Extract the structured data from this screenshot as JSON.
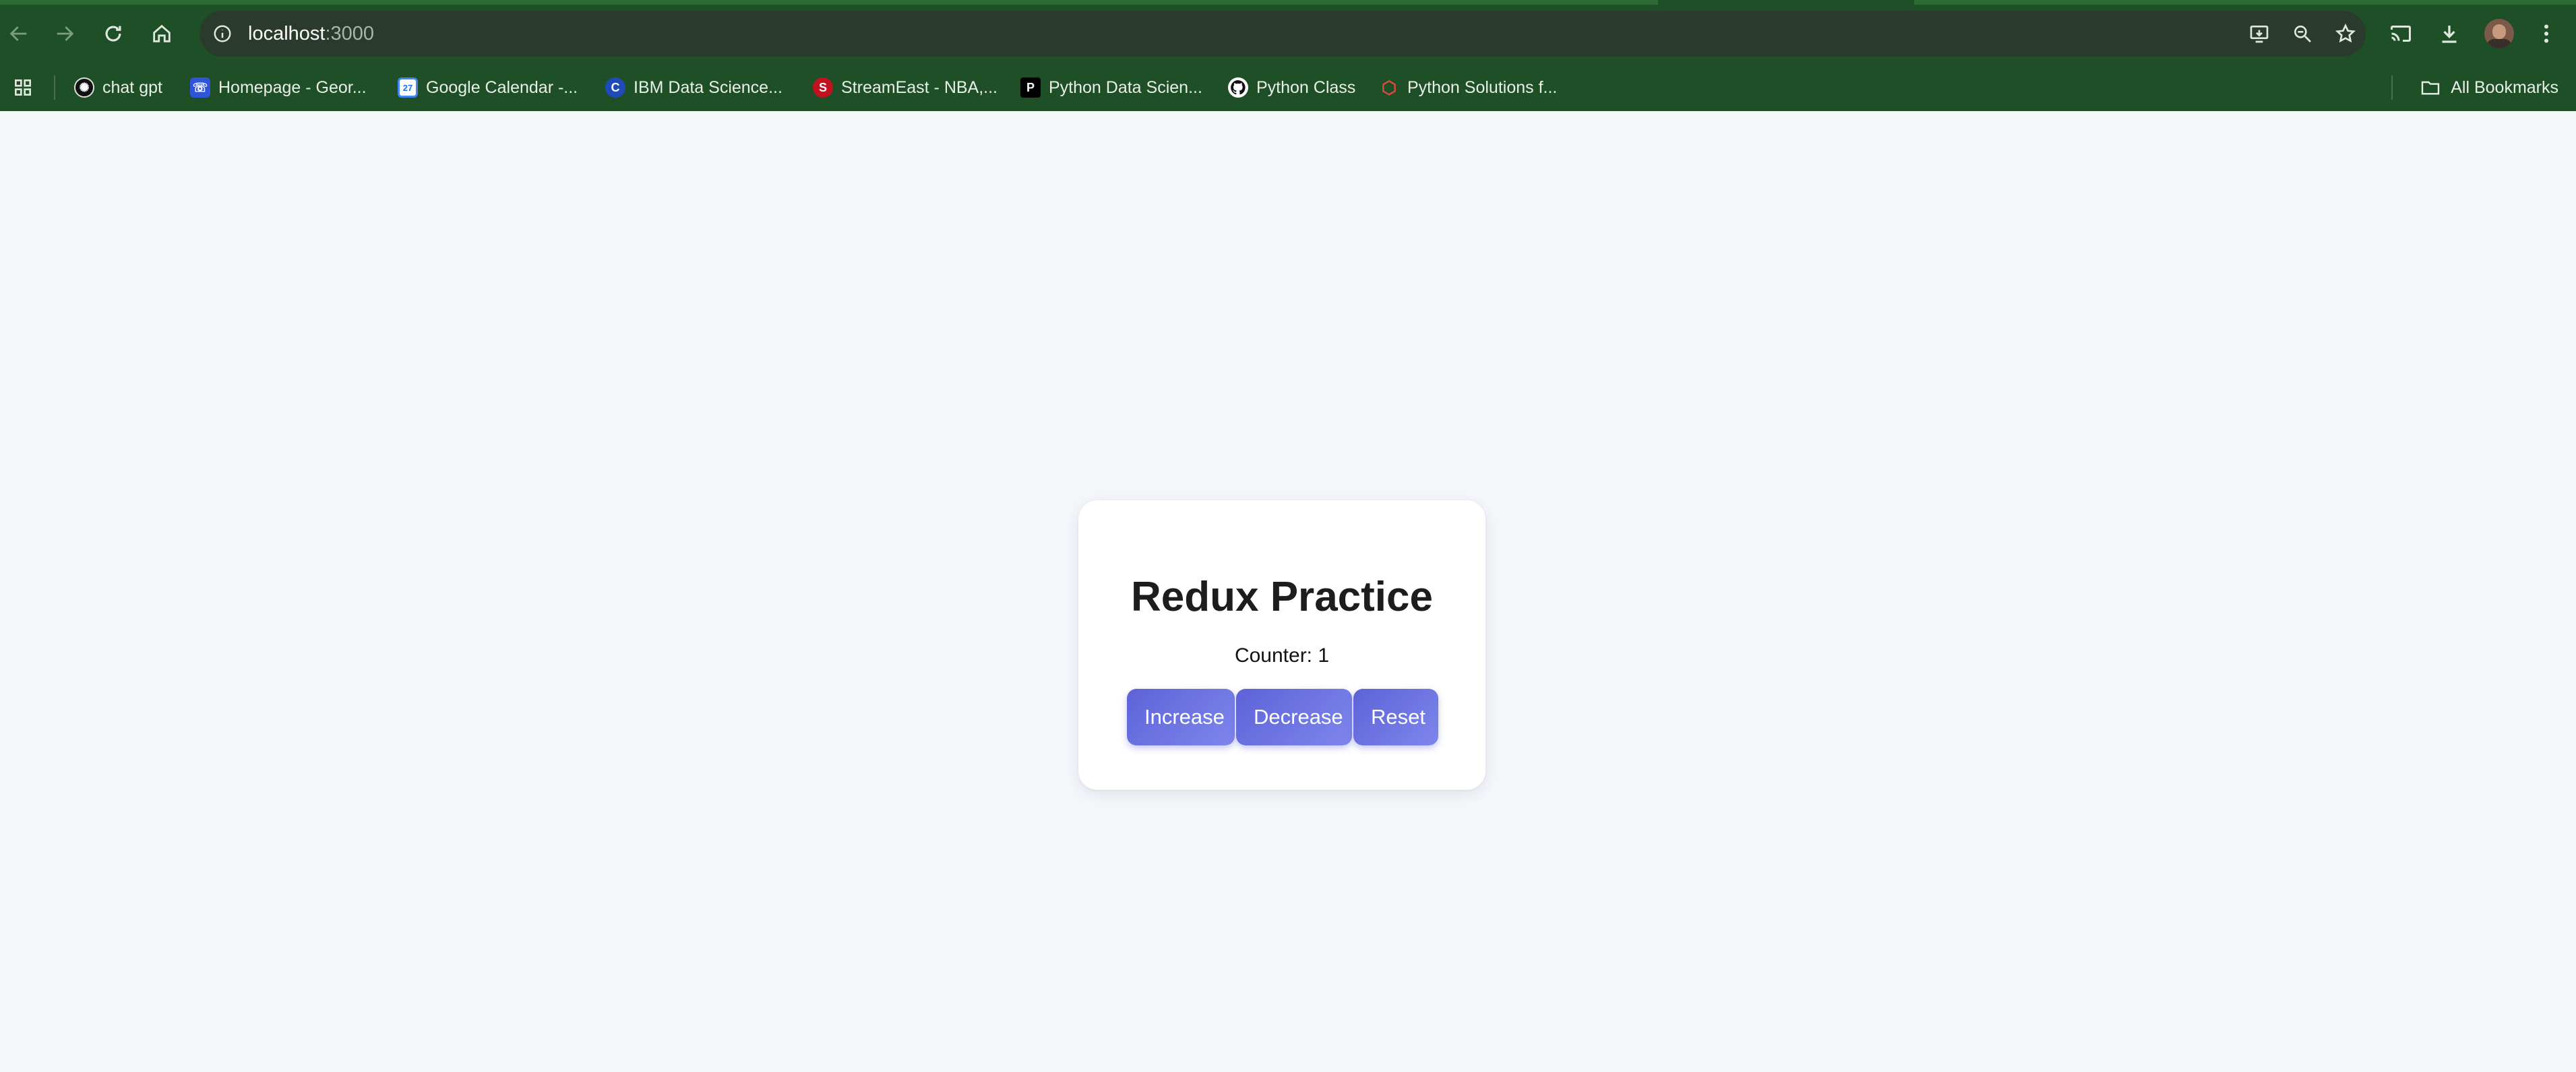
{
  "browser": {
    "url_host": "localhost",
    "url_port": ":3000",
    "bookmarks": [
      {
        "label": "chat gpt",
        "icon": "chatgpt-icon"
      },
      {
        "label": "Homepage - Geor...",
        "icon": "homepage-icon"
      },
      {
        "label": "Google Calendar -...",
        "icon": "calendar-icon",
        "favicon_text": "27"
      },
      {
        "label": "IBM Data Science...",
        "icon": "coursera-icon",
        "favicon_text": "C"
      },
      {
        "label": "StreamEast - NBA,...",
        "icon": "streameast-icon",
        "favicon_text": "S"
      },
      {
        "label": "Python Data Scien...",
        "icon": "python-data-science-icon",
        "favicon_text": "P"
      },
      {
        "label": "Python Class",
        "icon": "github-icon"
      },
      {
        "label": "Python Solutions f...",
        "icon": "python-solutions-icon"
      }
    ],
    "all_bookmarks_label": "All Bookmarks",
    "colors": {
      "chrome": "#1f4f26",
      "omnibox": "#2a3a2c"
    }
  },
  "app": {
    "title": "Redux Practice",
    "counter_label": "Counter: 1",
    "buttons": {
      "increase": "Increase",
      "decrease": "Decrease",
      "reset": "Reset"
    },
    "colors": {
      "button_start": "#5d63d8",
      "button_end": "#7e86ec",
      "card": "#ffffff",
      "background": "#f5f7fb"
    }
  }
}
